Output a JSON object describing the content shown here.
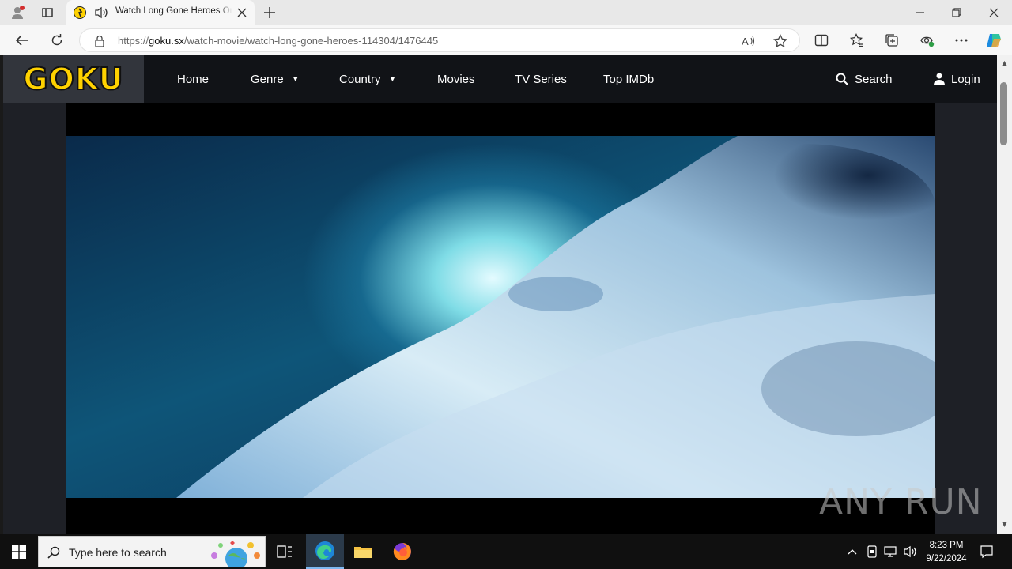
{
  "browser": {
    "tab_title": "Watch Long Gone Heroes Online",
    "url_prefix": "https://",
    "url_domain": "goku.sx",
    "url_path": "/watch-movie/watch-long-gone-heroes-114304/1476445"
  },
  "site": {
    "logo_text": "GOKU",
    "nav": {
      "home": "Home",
      "genre": "Genre",
      "country": "Country",
      "movies": "Movies",
      "tv_series": "TV Series",
      "top_imdb": "Top IMDb",
      "search": "Search",
      "login": "Login"
    }
  },
  "watermark": "ANY RUN",
  "taskbar": {
    "search_placeholder": "Type here to search",
    "time": "8:23 PM",
    "date": "9/22/2024"
  },
  "icons": {
    "profile": "profile-icon",
    "tab_actions": "tab-actions-icon",
    "favicon": "goku-favicon-icon",
    "audio": "speaker-icon",
    "close_tab": "close-icon",
    "new_tab": "plus-icon",
    "back": "back-arrow-icon",
    "refresh": "refresh-icon",
    "lock": "lock-icon",
    "read_aloud": "read-aloud-icon",
    "favorite": "star-icon",
    "split": "split-screen-icon",
    "favorites": "favorites-icon",
    "collections": "collections-icon",
    "extensions": "extension-icon",
    "more": "more-icon",
    "copilot": "copilot-icon",
    "search": "search-icon",
    "user": "user-icon",
    "windows": "windows-start-icon"
  }
}
